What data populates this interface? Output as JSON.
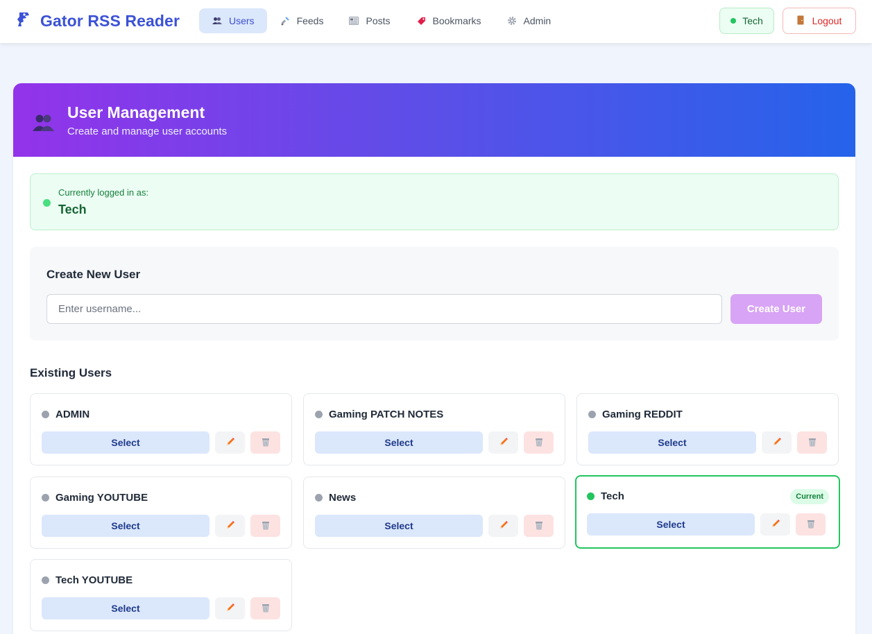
{
  "navbar": {
    "brand_title": "Gator RSS Reader",
    "brand_icon": "gator-icon",
    "links": [
      {
        "label": "Users",
        "icon": "users-icon",
        "active": true
      },
      {
        "label": "Feeds",
        "icon": "satellite-icon",
        "active": false
      },
      {
        "label": "Posts",
        "icon": "newspaper-icon",
        "active": false
      },
      {
        "label": "Bookmarks",
        "icon": "bookmark-icon",
        "active": false
      },
      {
        "label": "Admin",
        "icon": "gear-icon",
        "active": false
      }
    ],
    "current_user": "Tech",
    "logout_label": "Logout"
  },
  "header": {
    "title": "User Management",
    "subtitle": "Create and manage user accounts"
  },
  "logged_in": {
    "label": "Currently logged in as:",
    "username": "Tech"
  },
  "create_user": {
    "title": "Create New User",
    "placeholder": "Enter username...",
    "value": "",
    "button_label": "Create User"
  },
  "existing_users": {
    "title": "Existing Users",
    "select_label": "Select",
    "current_badge": "Current",
    "users": [
      {
        "name": "ADMIN",
        "current": false
      },
      {
        "name": "Gaming PATCH NOTES",
        "current": false
      },
      {
        "name": "Gaming REDDIT",
        "current": false
      },
      {
        "name": "Gaming YOUTUBE",
        "current": false
      },
      {
        "name": "News",
        "current": false
      },
      {
        "name": "Tech",
        "current": true
      },
      {
        "name": "Tech YOUTUBE",
        "current": false
      }
    ]
  },
  "colors": {
    "brand": "#3b52d6",
    "header_gradient_start": "#9333ea",
    "header_gradient_end": "#2563eb",
    "current_accent": "#22c55e",
    "create_button": "#d8a4f5"
  }
}
